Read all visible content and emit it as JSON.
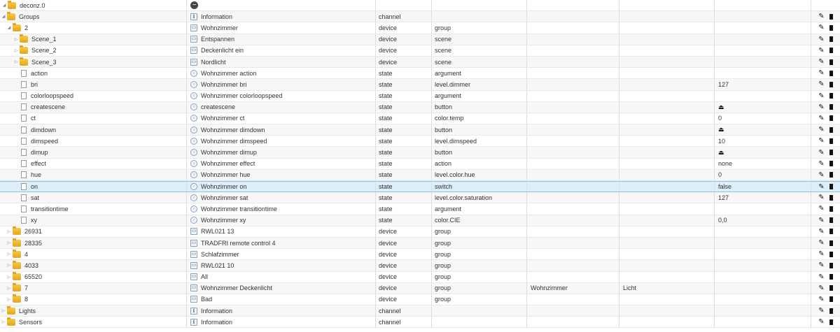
{
  "root": {
    "label": "deconz.0",
    "action_icon": "minus-circle-icon"
  },
  "rows": [
    {
      "level": 1,
      "tog": "open",
      "icon": "folder",
      "id": "Groups",
      "nicon": "info",
      "name": "Information",
      "type": "channel",
      "role": "",
      "room": "",
      "func": "",
      "value": "",
      "val_icon": ""
    },
    {
      "level": 2,
      "tog": "open",
      "icon": "folder",
      "id": "2",
      "nicon": "device",
      "name": "Wohnzimmer",
      "type": "device",
      "role": "group",
      "room": "",
      "func": "",
      "value": "",
      "val_icon": ""
    },
    {
      "level": 3,
      "tog": "closed",
      "icon": "folder",
      "id": "Scene_1",
      "nicon": "device",
      "name": "Entspannen",
      "type": "device",
      "role": "scene",
      "room": "",
      "func": "",
      "value": "",
      "val_icon": ""
    },
    {
      "level": 3,
      "tog": "closed",
      "icon": "folder",
      "id": "Scene_2",
      "nicon": "device",
      "name": "Deckenlicht ein",
      "type": "device",
      "role": "scene",
      "room": "",
      "func": "",
      "value": "",
      "val_icon": ""
    },
    {
      "level": 3,
      "tog": "closed",
      "icon": "folder",
      "id": "Scene_3",
      "nicon": "device",
      "name": "Nordlicht",
      "type": "device",
      "role": "scene",
      "room": "",
      "func": "",
      "value": "",
      "val_icon": ""
    },
    {
      "level": 3,
      "tog": "",
      "icon": "file",
      "id": "action",
      "nicon": "state",
      "name": "Wohnzimmer action",
      "type": "state",
      "role": "argument",
      "room": "",
      "func": "",
      "value": "",
      "val_icon": ""
    },
    {
      "level": 3,
      "tog": "",
      "icon": "file",
      "id": "bri",
      "nicon": "state",
      "name": "Wohnzimmer bri",
      "type": "state",
      "role": "level.dimmer",
      "room": "",
      "func": "",
      "value": "127",
      "val_icon": ""
    },
    {
      "level": 3,
      "tog": "",
      "icon": "file",
      "id": "colorloopspeed",
      "nicon": "state",
      "name": "Wohnzimmer colorloopspeed",
      "type": "state",
      "role": "argument",
      "room": "",
      "func": "",
      "value": "",
      "val_icon": ""
    },
    {
      "level": 3,
      "tog": "",
      "icon": "file",
      "id": "createscene",
      "nicon": "state",
      "name": "createscene",
      "type": "state",
      "role": "button",
      "room": "",
      "func": "",
      "value": "",
      "val_icon": "eject-icon"
    },
    {
      "level": 3,
      "tog": "",
      "icon": "file",
      "id": "ct",
      "nicon": "state",
      "name": "Wohnzimmer ct",
      "type": "state",
      "role": "color.temp",
      "room": "",
      "func": "",
      "value": "0",
      "val_icon": ""
    },
    {
      "level": 3,
      "tog": "",
      "icon": "file",
      "id": "dimdown",
      "nicon": "state",
      "name": "Wohnzimmer dimdown",
      "type": "state",
      "role": "button",
      "room": "",
      "func": "",
      "value": "",
      "val_icon": "eject-icon"
    },
    {
      "level": 3,
      "tog": "",
      "icon": "file",
      "id": "dimspeed",
      "nicon": "state",
      "name": "Wohnzimmer dimspeed",
      "type": "state",
      "role": "level.dimspeed",
      "room": "",
      "func": "",
      "value": "10",
      "val_icon": ""
    },
    {
      "level": 3,
      "tog": "",
      "icon": "file",
      "id": "dimup",
      "nicon": "state",
      "name": "Wohnzimmer dimup",
      "type": "state",
      "role": "button",
      "room": "",
      "func": "",
      "value": "",
      "val_icon": "eject-icon"
    },
    {
      "level": 3,
      "tog": "",
      "icon": "file",
      "id": "effect",
      "nicon": "state",
      "name": "Wohnzimmer effect",
      "type": "state",
      "role": "action",
      "room": "",
      "func": "",
      "value": "none",
      "val_icon": ""
    },
    {
      "level": 3,
      "tog": "",
      "icon": "file",
      "id": "hue",
      "nicon": "state",
      "name": "Wohnzimmer hue",
      "type": "state",
      "role": "level.color.hue",
      "room": "",
      "func": "",
      "value": "0",
      "val_icon": ""
    },
    {
      "level": 3,
      "tog": "",
      "icon": "file",
      "id": "on",
      "nicon": "state",
      "name": "Wohnzimmer on",
      "type": "state",
      "role": "switch",
      "room": "",
      "func": "",
      "value": "false",
      "val_icon": "",
      "selected": true
    },
    {
      "level": 3,
      "tog": "",
      "icon": "file",
      "id": "sat",
      "nicon": "state",
      "name": "Wohnzimmer sat",
      "type": "state",
      "role": "level.color.saturation",
      "room": "",
      "func": "",
      "value": "127",
      "val_icon": ""
    },
    {
      "level": 3,
      "tog": "",
      "icon": "file",
      "id": "transitiontime",
      "nicon": "state",
      "name": "Wohnzimmer transitiontime",
      "type": "state",
      "role": "argument",
      "room": "",
      "func": "",
      "value": "",
      "val_icon": ""
    },
    {
      "level": 3,
      "tog": "",
      "icon": "file",
      "id": "xy",
      "nicon": "state",
      "name": "Wohnzimmer xy",
      "type": "state",
      "role": "color.CIE",
      "room": "",
      "func": "",
      "value": "0,0",
      "val_icon": ""
    },
    {
      "level": 2,
      "tog": "closed",
      "icon": "folder",
      "id": "26931",
      "nicon": "device",
      "name": "RWL021 13",
      "type": "device",
      "role": "group",
      "room": "",
      "func": "",
      "value": "",
      "val_icon": ""
    },
    {
      "level": 2,
      "tog": "closed",
      "icon": "folder",
      "id": "28335",
      "nicon": "device",
      "name": "TRADFRI remote control 4",
      "type": "device",
      "role": "group",
      "room": "",
      "func": "",
      "value": "",
      "val_icon": ""
    },
    {
      "level": 2,
      "tog": "closed",
      "icon": "folder",
      "id": "4",
      "nicon": "device",
      "name": "Schlafzimmer",
      "type": "device",
      "role": "group",
      "room": "",
      "func": "",
      "value": "",
      "val_icon": ""
    },
    {
      "level": 2,
      "tog": "closed",
      "icon": "folder",
      "id": "4033",
      "nicon": "device",
      "name": "RWL021 10",
      "type": "device",
      "role": "group",
      "room": "",
      "func": "",
      "value": "",
      "val_icon": ""
    },
    {
      "level": 2,
      "tog": "closed",
      "icon": "folder",
      "id": "65520",
      "nicon": "device",
      "name": "All",
      "type": "device",
      "role": "group",
      "room": "",
      "func": "",
      "value": "",
      "val_icon": ""
    },
    {
      "level": 2,
      "tog": "closed",
      "icon": "folder",
      "id": "7",
      "nicon": "device",
      "name": "Wohnzimmer Deckenlicht",
      "type": "device",
      "role": "group",
      "room": "Wohnzimmer",
      "func": "Licht",
      "value": "",
      "val_icon": ""
    },
    {
      "level": 2,
      "tog": "closed",
      "icon": "folder",
      "id": "8",
      "nicon": "device",
      "name": "Bad",
      "type": "device",
      "role": "group",
      "room": "",
      "func": "",
      "value": "",
      "val_icon": ""
    },
    {
      "level": 1,
      "tog": "closed",
      "icon": "folder",
      "id": "Lights",
      "nicon": "info",
      "name": "Information",
      "type": "channel",
      "role": "",
      "room": "",
      "func": "",
      "value": "",
      "val_icon": ""
    },
    {
      "level": 1,
      "tog": "closed",
      "icon": "folder",
      "id": "Sensors",
      "nicon": "info",
      "name": "Information",
      "type": "channel",
      "role": "",
      "room": "",
      "func": "",
      "value": "",
      "val_icon": ""
    }
  ],
  "row_actions": {
    "edit_icon": "pencil-icon",
    "delete_icon": "trash-icon"
  }
}
